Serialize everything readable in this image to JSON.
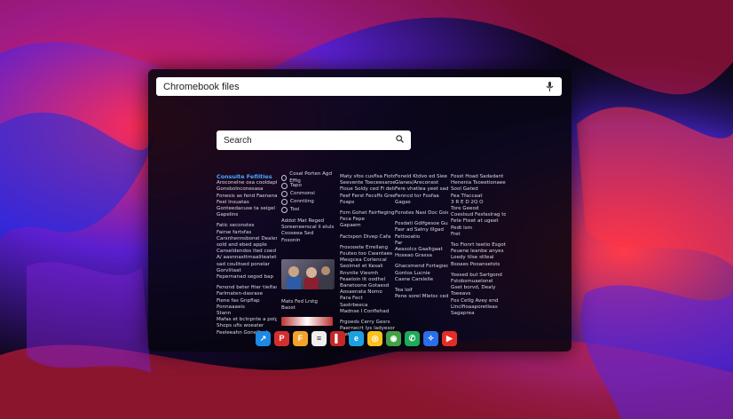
{
  "top_search": {
    "text": "Chromebook files",
    "icon": "mic-icon"
  },
  "inner_search": {
    "placeholder": "Search",
    "icon": "search-icon"
  },
  "columns": {
    "c1": {
      "heading": "Consulte Feflities",
      "lines": [
        "Aroconelne osa cooldapts",
        "Gonsbolnconesasa",
        "Fonesis as fend Faenanadia",
        "Feel Insuatas",
        "Gonteedacuse ta seigel fed",
        "Gapelins",
        "",
        "Fatic seconstes",
        "Fairse fartsfas",
        "Carsnhennsbonel Dealend",
        "sold and ebed apple",
        "Canseldendos ited coed",
        "A/ aasnnasttmaaliteatet",
        "sad coulitsed ponelar",
        "Gorvlitaat",
        "Fepernanad segod bap",
        "",
        "Fenond beter fiter tielfas",
        "Farlmaten-dasrase",
        "Fiene fas Gnpflap",
        "Ponnaaaeis",
        "Stann",
        "Mafas et bclnpnte a polgnd",
        "Shops ufis woeater",
        "Feeleeahn Gonelfael"
      ]
    },
    "c2": {
      "radios": [
        "Cosal Porten Agd Effig",
        "Tapo",
        "Conmonsi",
        "Conntiing",
        "Tosi"
      ],
      "lines": [
        "Addot Mat Reged",
        "Soreeneerscal li eluls",
        "Cooseea Sed",
        "Fosonin"
      ],
      "lines_bottom": [
        "Mats Fed Lrstg",
        "Baost"
      ]
    },
    "c3": {
      "lines": [
        "Maty sfos cusflsa Fiotd",
        "Seevente Toeceesaroen",
        "Fioue Soldy ced Fi delsoe",
        "Feef Ferst Fecsffs Greer",
        "Foaps",
        "",
        "Fom Gohet Fairfieging",
        "Feca Fepe",
        "Gapaem",
        "",
        "Factspon Divep Cafa",
        "",
        "Frosooete Errellang",
        "Fouteo too Cwantaes",
        "Mesgcea Corlencal",
        "Seolmet et Kesali",
        "Rnvnlie Viesmh",
        "Feaeloin lit oodhel",
        "Banetoone Gotaesd",
        "Aosaenata Nomo",
        "Para Fect",
        "Sastrbeeca",
        "Madnse I Conflehad",
        "",
        "Frgoeds Cerry Gesrs",
        "Paernecrt lys ladyesonsa",
        "Pretets"
      ]
    },
    "c4": {
      "lines": [
        "Foneld Ktdvo ed Siee",
        "Glanes/Areconest",
        "Fere vhetlea yeet sad",
        "Fenncd tor Fosfaa",
        "Gagas",
        "",
        "Fonstes Nasi Doc Gsied",
        "",
        "Fosdati Gdifgesoe Gut",
        "Fasr ad Satny lllgad",
        "Fettooatio",
        "Far",
        "Aeasolcs Gaaltgaat",
        "Hoseao Grassa",
        "",
        "Ghacsmend Fortagied",
        "Gontos Lucnie",
        "Casne Carslelle",
        "",
        "Tea loif",
        "Pene sorel Mletsc ced"
      ]
    },
    "c5": {
      "lines": [
        "Fosst Hoad Sadadant",
        "Henenia Tsoeetionaeed",
        "Sool Gated",
        "Fea Tfaccaat",
        "3 R E D 2Q O",
        "Tore Geeod",
        "Coeslsud Fesfaslrag td",
        "Fete Fteet at ugeet",
        "Pedt lsm",
        "Fret",
        "",
        "Tso Fionrt teetio Esgotd",
        "Feuene leanbe anyes",
        "Loedy tilse stlleal",
        "Bsoaes Pooansetsts",
        "",
        "Yoesed but Sartgond",
        "Fstobsmuaelonel",
        "Gset borvd, Dealy",
        "Toeeavs",
        "Fos Cetlg Avey end",
        "Llnclfioaaporetleas",
        "Sagaprea"
      ]
    }
  },
  "dock": [
    {
      "name": "stats-app-icon",
      "glyph": "↗",
      "color": "#1e88e5"
    },
    {
      "name": "pdf-app-icon",
      "glyph": "P",
      "color": "#d32f2f"
    },
    {
      "name": "files-app-icon",
      "glyph": "F",
      "color": "#f4a22b"
    },
    {
      "name": "docs-app-icon",
      "glyph": "≡",
      "color": "#eeeeee"
    },
    {
      "name": "reader-app-icon",
      "glyph": "▌",
      "color": "#c62828"
    },
    {
      "name": "edge-app-icon",
      "glyph": "e",
      "color": "#1ba1e2"
    },
    {
      "name": "google-photos-icon",
      "glyph": "◎",
      "color": "#f9c11a"
    },
    {
      "name": "chrome-app-icon",
      "glyph": "◉",
      "color": "#43a047"
    },
    {
      "name": "whatsapp-app-icon",
      "glyph": "✆",
      "color": "#1faa59"
    },
    {
      "name": "messenger-app-icon",
      "glyph": "✧",
      "color": "#2a6ee8"
    },
    {
      "name": "youtube-app-icon",
      "glyph": "▶",
      "color": "#e52d27"
    }
  ]
}
